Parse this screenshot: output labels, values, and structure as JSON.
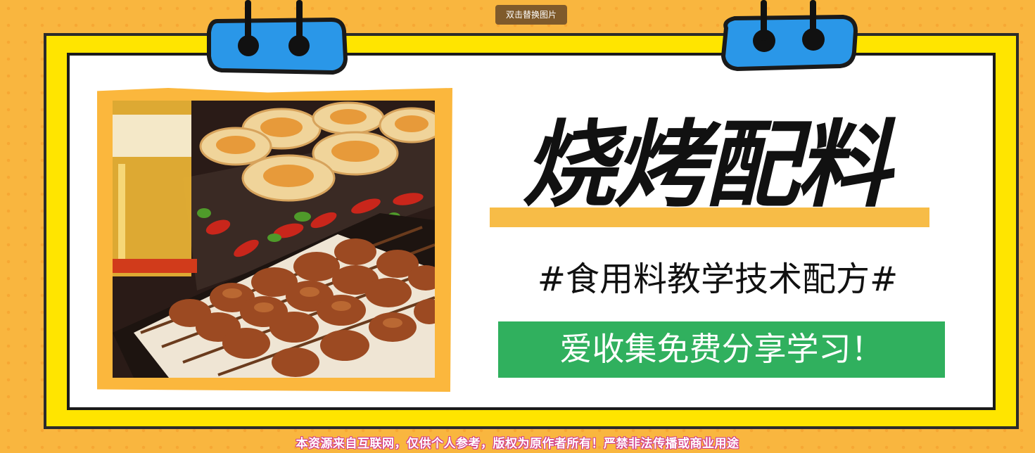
{
  "toolbar": {
    "replace_image_label": "双击替换图片"
  },
  "banner": {
    "title": "烧烤配料",
    "subtitle": "#食用料教学技术配方#",
    "cta": "爱收集免费分享学习！",
    "footer_note": "本资源来自互联网，仅供个人参考，版权为原作者所有！严禁非法传播或商业用途"
  },
  "colors": {
    "background": "#f9b63f",
    "outer_frame": "#ffe500",
    "hanger_blue": "#2a97e8",
    "cta_green": "#30b05e",
    "title_underline": "#f7bc47",
    "footer_outline": "#d23c8b"
  },
  "image": {
    "subject": "barbecue skewers, scallops, chili peppers and beer"
  }
}
